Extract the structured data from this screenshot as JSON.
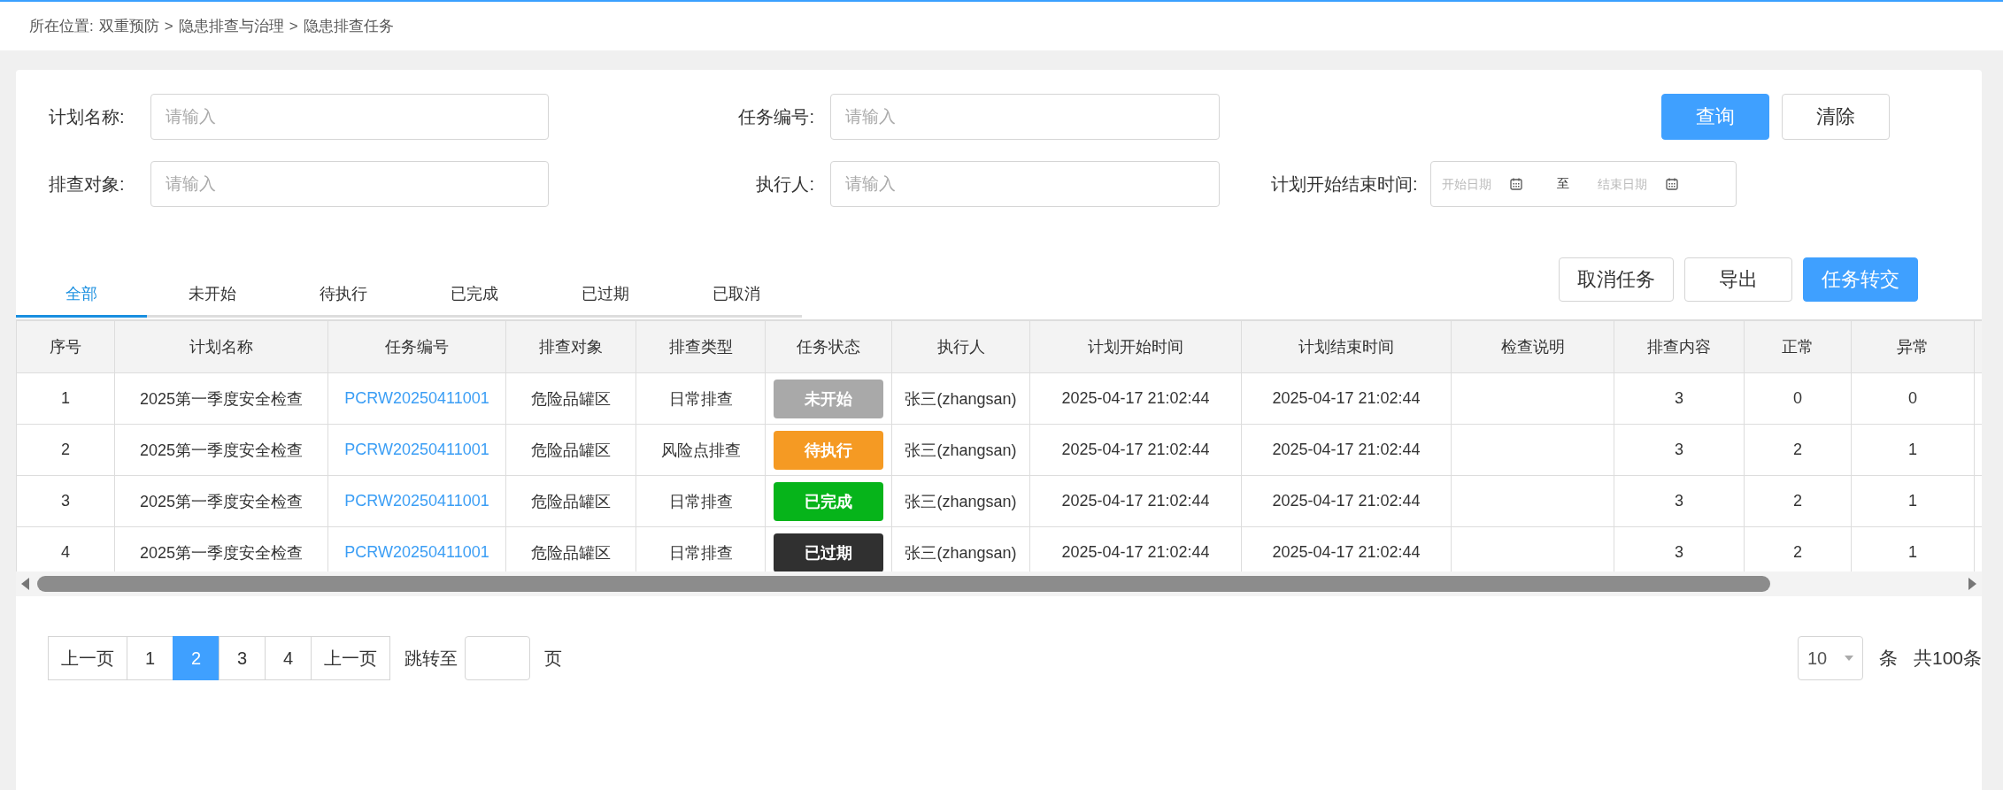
{
  "breadcrumb": {
    "label": "所在位置:",
    "items": [
      "双重预防",
      "隐患排查与治理",
      "隐患排查任务"
    ],
    "separator": ">"
  },
  "filters": [
    {
      "label": "计划名称:",
      "placeholder": "请输入"
    },
    {
      "label": "任务编号:",
      "placeholder": "请输入"
    },
    {
      "label": "排查对象:",
      "placeholder": "请输入"
    },
    {
      "label": "执行人:",
      "placeholder": "请输入"
    }
  ],
  "date_range": {
    "label": "计划开始结束时间:",
    "start_placeholder": "开始日期",
    "separator": "至",
    "end_placeholder": "结束日期"
  },
  "search_buttons": [
    {
      "label": "查询",
      "primary": true
    },
    {
      "label": "清除",
      "primary": false
    }
  ],
  "tabs": [
    {
      "label": "全部",
      "selected": true
    },
    {
      "label": "未开始",
      "selected": false
    },
    {
      "label": "待执行",
      "selected": false
    },
    {
      "label": "已完成",
      "selected": false
    },
    {
      "label": "已过期",
      "selected": false
    },
    {
      "label": "已取消",
      "selected": false
    }
  ],
  "action_buttons": [
    {
      "label": "取消任务",
      "primary": false
    },
    {
      "label": "导出",
      "primary": false
    },
    {
      "label": "任务转交",
      "primary": true
    }
  ],
  "table": {
    "columns": [
      "序号",
      "计划名称",
      "任务编号",
      "排查对象",
      "排查类型",
      "任务状态",
      "执行人",
      "计划开始时间",
      "计划结束时间",
      "检查说明",
      "排查内容",
      "正常",
      "异常"
    ],
    "rows": [
      {
        "index": "1",
        "plan": "2025第一季度安全检查",
        "task_no": "PCRW20250411001",
        "target": "危险品罐区",
        "type": "日常排查",
        "status": {
          "label": "未开始",
          "color": "#a9a9a9"
        },
        "executor": "张三(zhangsan)",
        "start": "2025-04-17 21:02:44",
        "end": "2025-04-17 21:02:44",
        "note": "",
        "content": "3",
        "normal": "0",
        "abnormal": "0"
      },
      {
        "index": "2",
        "plan": "2025第一季度安全检查",
        "task_no": "PCRW20250411001",
        "target": "危险品罐区",
        "type": "风险点排查",
        "status": {
          "label": "待执行",
          "color": "#f59a23"
        },
        "executor": "张三(zhangsan)",
        "start": "2025-04-17 21:02:44",
        "end": "2025-04-17 21:02:44",
        "note": "",
        "content": "3",
        "normal": "2",
        "abnormal": "1"
      },
      {
        "index": "3",
        "plan": "2025第一季度安全检查",
        "task_no": "PCRW20250411001",
        "target": "危险品罐区",
        "type": "日常排查",
        "status": {
          "label": "已完成",
          "color": "#06b41a"
        },
        "executor": "张三(zhangsan)",
        "start": "2025-04-17 21:02:44",
        "end": "2025-04-17 21:02:44",
        "note": "",
        "content": "3",
        "normal": "2",
        "abnormal": "1"
      },
      {
        "index": "4",
        "plan": "2025第一季度安全检查",
        "task_no": "PCRW20250411001",
        "target": "危险品罐区",
        "type": "日常排查",
        "status": {
          "label": "已过期",
          "color": "#303030"
        },
        "executor": "张三(zhangsan)",
        "start": "2025-04-17 21:02:44",
        "end": "2025-04-17 21:02:44",
        "note": "",
        "content": "3",
        "normal": "2",
        "abnormal": "1"
      }
    ]
  },
  "pagination": {
    "prev": "上一页",
    "pages": [
      {
        "label": "1",
        "selected": false
      },
      {
        "label": "2",
        "selected": true
      },
      {
        "label": "3",
        "selected": false
      },
      {
        "label": "4",
        "selected": false
      }
    ],
    "next": "上一页",
    "jump_label": "跳转至",
    "jump_suffix": "页",
    "page_size": "10",
    "page_size_unit": "条",
    "total": "共100条"
  }
}
